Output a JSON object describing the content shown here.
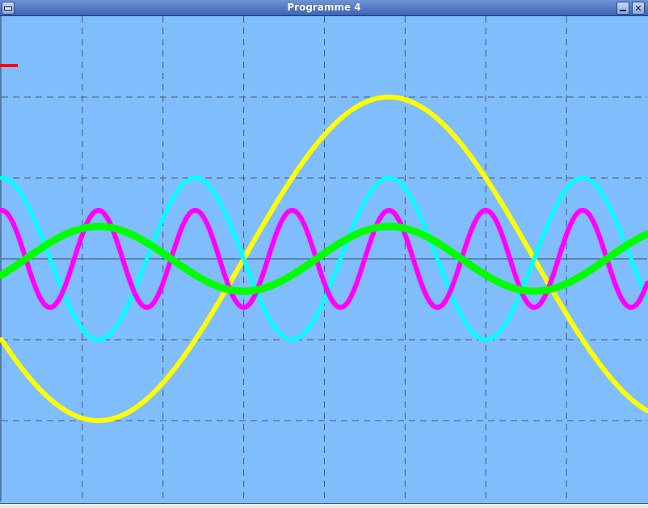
{
  "window": {
    "title": "Programme 4"
  },
  "colors": {
    "background": "#80bdfd",
    "grid": "#4a5a6e",
    "axis": "#3c4a5a",
    "marker": "#ff0000"
  },
  "icons": {
    "menu": "window-menu-icon",
    "minimize": "minimize-icon",
    "close": "close-icon"
  },
  "chart_data": {
    "type": "line",
    "grid": true,
    "grid_style": "dashed",
    "xlim": [
      0,
      8
    ],
    "ylim": [
      -3,
      3
    ],
    "series": [
      {
        "color": "#ffff00",
        "amplitude": 2.0,
        "period": 7.2,
        "phase_x": 1.2,
        "sign": -1,
        "width": 6
      },
      {
        "color": "#00ffff",
        "amplitude": 1.0,
        "period": 2.4,
        "phase_x": 1.2,
        "sign": -1,
        "width": 5
      },
      {
        "color": "#ff00ff",
        "amplitude": 0.6,
        "period": 1.2,
        "phase_x": 1.2,
        "sign": 1,
        "width": 6
      },
      {
        "color": "#00ff00",
        "amplitude": 0.4,
        "period": 3.6,
        "phase_x": 1.2,
        "sign": 1,
        "width": 9
      }
    ]
  }
}
